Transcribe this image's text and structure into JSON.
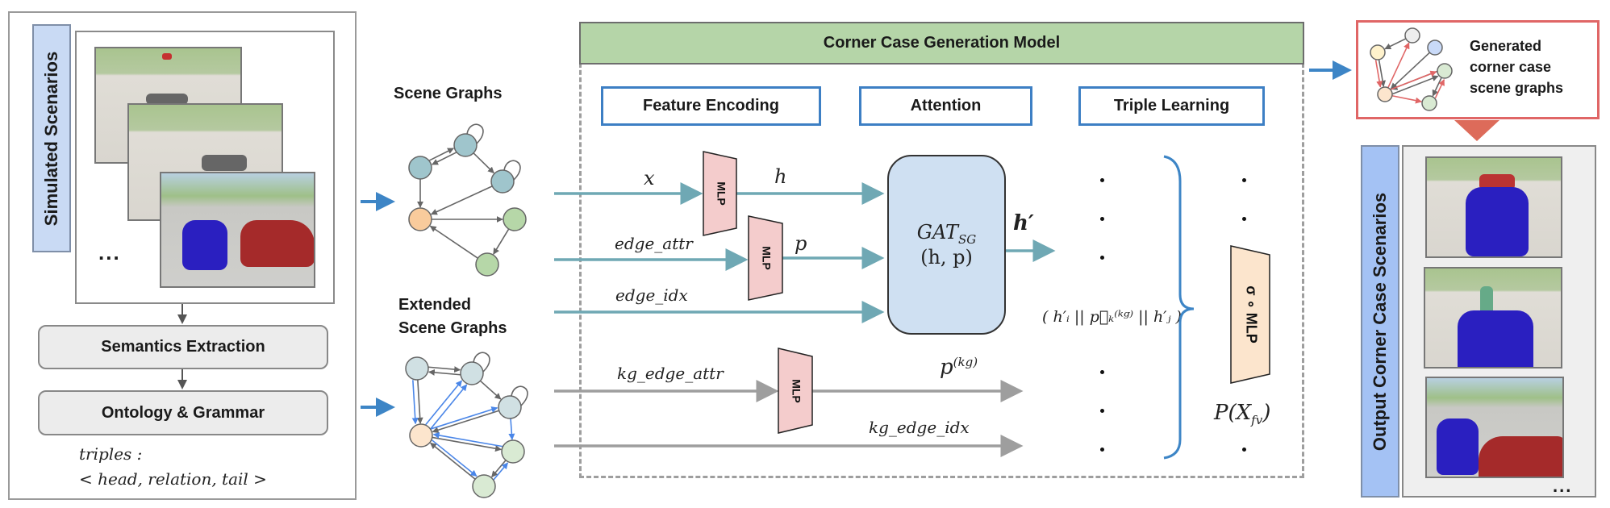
{
  "left_panel": {
    "label": "Simulated Scenarios",
    "ellipsis": "...",
    "scenario_frames": [
      "scenario-1",
      "scenario-2",
      "scenario-3"
    ],
    "step1": "Semantics Extraction",
    "step2": "Ontology & Grammar",
    "triples_label": "triples :",
    "triples_format": "< head, relation, tail >"
  },
  "graphs": {
    "scene_graphs_title": "Scene Graphs",
    "extended_title_line1": "Extended",
    "extended_title_line2": "Scene Graphs"
  },
  "model": {
    "title": "Corner Case Generation Model",
    "sections": [
      "Feature Encoding",
      "Attention",
      "Triple Learning"
    ],
    "inputs": {
      "x": "x",
      "h": "h",
      "edge_attr": "edge_attr",
      "p": "p",
      "edge_idx": "edge_idx",
      "kg_edge_attr": "kg_edge_attr",
      "p_kg": "p",
      "p_kg_sup": "(kg)",
      "kg_edge_idx": "kg_edge_idx"
    },
    "mlp_label": "MLP",
    "gat_line1": "GAT",
    "gat_sub": "SG",
    "gat_line2": "(h, p)",
    "h_prime": "h′",
    "triple_formula": "( h′ᵢ || p⃗ₖ⁽ᵏᵍ⁾ || h′ⱼ )",
    "sigma_mlp": "σ ∘ MLP",
    "output_prob": "P(X",
    "output_prob_sub": "fv",
    "output_prob_close": ")"
  },
  "right_panel": {
    "generated_label_line1": "Generated",
    "generated_label_line2": "corner case",
    "generated_label_line3": "scene graphs",
    "output_label": "Output Corner Case Scenarios",
    "ellipsis": "...",
    "output_frames": [
      "output-1",
      "output-2",
      "output-3"
    ]
  },
  "colors": {
    "flow_teal": "#6fa8b4",
    "flow_grey": "#9e9e9e",
    "flow_blue": "#3d85c6",
    "accent_red": "#e06666",
    "header_green": "#b5d5a8",
    "mlp_pink": "#f4cccc",
    "mlp_peach": "#fce5cd",
    "gat_blue": "#cfe0f2"
  }
}
